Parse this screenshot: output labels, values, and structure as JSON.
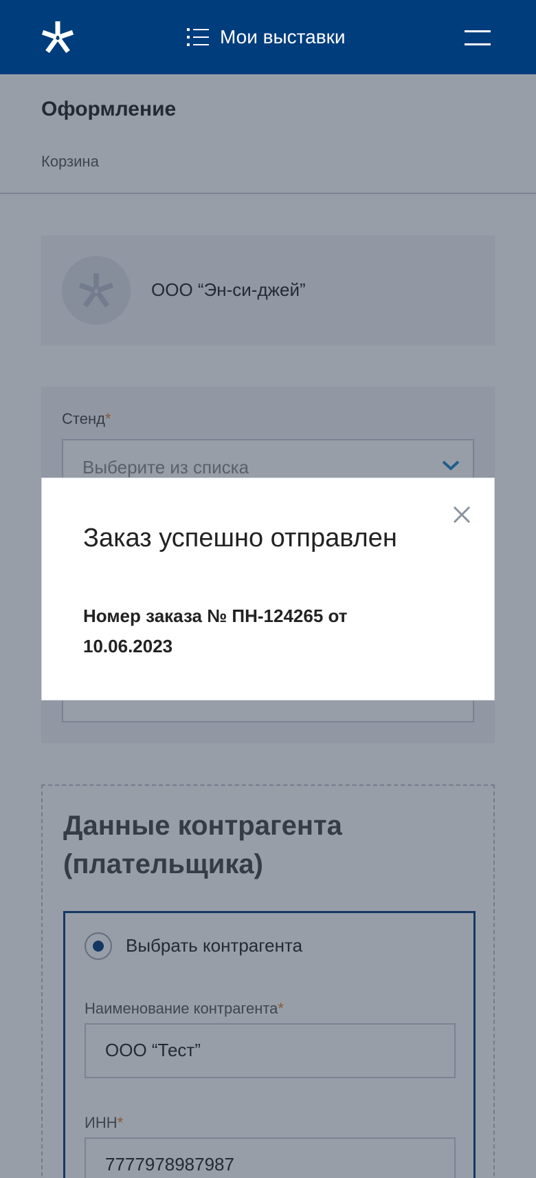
{
  "header": {
    "title": "Мои выставки",
    "logo_icon": "star-logo-icon",
    "menu_icon": "hamburger-menu-icon",
    "bg_color": "#003d7d"
  },
  "page": {
    "title": "Оформление",
    "breadcrumb": "Корзина"
  },
  "company": {
    "name": "ООО “Эн-си-джей”"
  },
  "stand": {
    "label": "Стенд",
    "required_mark": "*",
    "placeholder": "Выберите из списка"
  },
  "counterparty": {
    "title": "Данные контрагента (плательщика)",
    "radio_label": "Выбрать контрагента",
    "radio_selected": true,
    "name_label": "Наименование контрагента",
    "name_value": "ООО “Тест”",
    "inn_label": "ИНН",
    "inn_value": "7777978987987"
  },
  "modal": {
    "title": "Заказ успешно отправлен",
    "body": "Номер заказа № ПН-124265 от 10.06.2023",
    "close_icon": "close-icon"
  },
  "colors": {
    "accent": "#003d7d",
    "required": "#e07a1f",
    "chevron": "#1a86c7"
  }
}
